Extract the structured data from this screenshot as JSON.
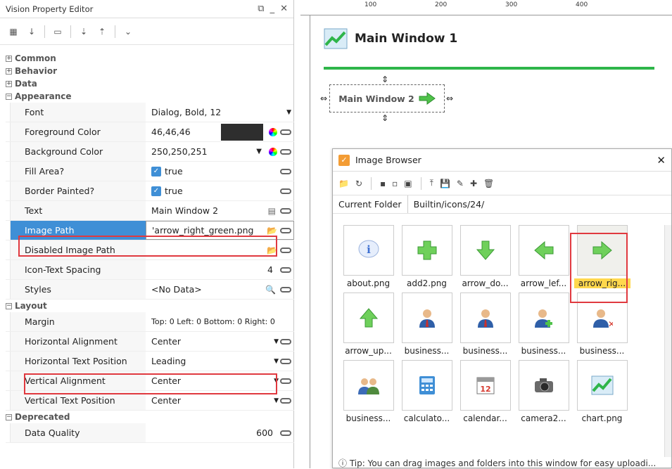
{
  "left": {
    "title": "Vision Property Editor",
    "categories": {
      "common": "Common",
      "behavior": "Behavior",
      "data": "Data",
      "appearance": "Appearance",
      "layout": "Layout",
      "deprecated": "Deprecated"
    },
    "appearance_rows": [
      {
        "name": "Font",
        "value": "Dialog, Bold, 12"
      },
      {
        "name": "Foreground Color",
        "value": "46,46,46"
      },
      {
        "name": "Background Color",
        "value": "250,250,251"
      },
      {
        "name": "Fill Area?",
        "value": "true"
      },
      {
        "name": "Border Painted?",
        "value": "true"
      },
      {
        "name": "Text",
        "value": "Main Window 2"
      },
      {
        "name": "Image Path",
        "value": "'arrow_right_green.png"
      },
      {
        "name": "Disabled Image Path",
        "value": ""
      },
      {
        "name": "Icon-Text Spacing",
        "value": "4"
      },
      {
        "name": "Styles",
        "value": "<No Data>"
      }
    ],
    "layout_rows": [
      {
        "name": "Margin",
        "value": "Top: 0 Left: 0 Bottom: 0 Right: 0"
      },
      {
        "name": "Horizontal Alignment",
        "value": "Center"
      },
      {
        "name": "Horizontal Text Position",
        "value": "Leading"
      },
      {
        "name": "Vertical Alignment",
        "value": "Center"
      },
      {
        "name": "Vertical Text Position",
        "value": "Center"
      }
    ],
    "deprecated_rows": [
      {
        "name": "Data Quality",
        "value": "600"
      }
    ]
  },
  "canvas": {
    "ruler_labels": [
      "100",
      "200",
      "300",
      "400"
    ],
    "window1_title": "Main Window 1",
    "window2_label": "Main Window 2"
  },
  "image_browser": {
    "title": "Image Browser",
    "current_folder_label": "Current Folder",
    "current_folder_value": "Builtin/icons/24/",
    "items": [
      {
        "name": "about.png",
        "icon": "info-icon"
      },
      {
        "name": "add2.png",
        "icon": "plus-icon"
      },
      {
        "name": "arrow_do...",
        "icon": "arrow-down-icon"
      },
      {
        "name": "arrow_lef...",
        "icon": "arrow-left-icon"
      },
      {
        "name": "arrow_rig...",
        "icon": "arrow-right-icon"
      },
      {
        "name": "arrow_up...",
        "icon": "arrow-up-icon"
      },
      {
        "name": "business...",
        "icon": "business-person-icon"
      },
      {
        "name": "business...",
        "icon": "business-person-icon"
      },
      {
        "name": "business...",
        "icon": "business-person-add-icon"
      },
      {
        "name": "business...",
        "icon": "business-person-remove-icon"
      },
      {
        "name": "business...",
        "icon": "business-people-icon"
      },
      {
        "name": "calculato...",
        "icon": "calculator-icon"
      },
      {
        "name": "calendar...",
        "icon": "calendar-icon"
      },
      {
        "name": "camera2...",
        "icon": "camera-icon"
      },
      {
        "name": "chart.png",
        "icon": "chart-icon"
      }
    ],
    "tip": "Tip: You can drag images and folders into this window for easy uploadi..."
  },
  "colors": {
    "accent": "#3f8fd6",
    "highlight": "#e0393f",
    "green": "#2fb54a"
  }
}
